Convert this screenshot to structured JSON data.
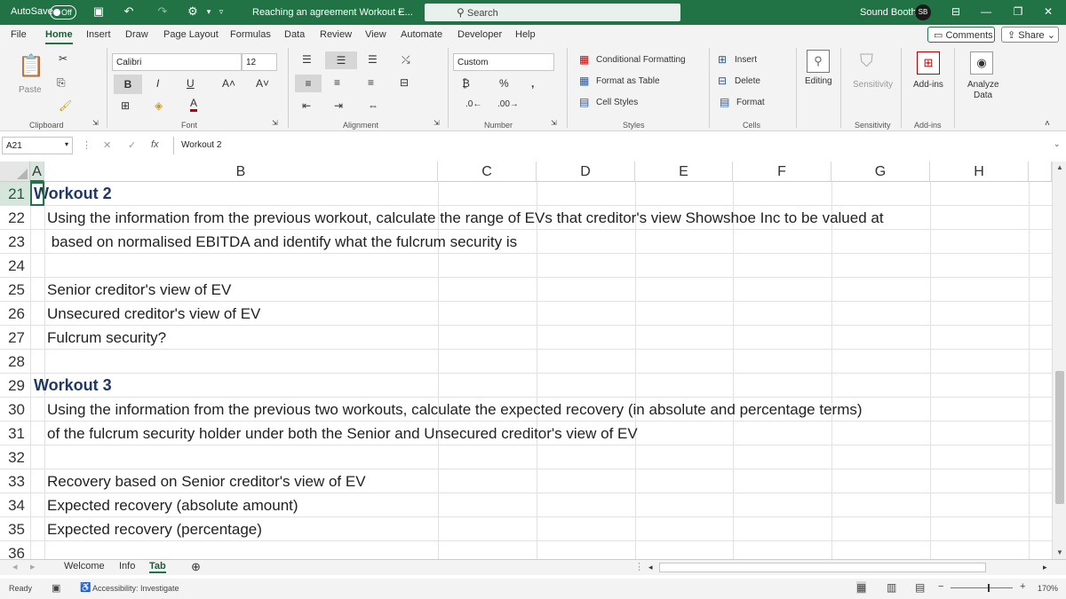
{
  "titlebar": {
    "autosave_label": "AutoSave",
    "autosave_state": "Off",
    "doc_title": "Reaching an agreement Workout E...",
    "search_placeholder": "Search",
    "user_name": "Sound Booth",
    "avatar_initials": "SB"
  },
  "menu": {
    "tabs": [
      "File",
      "Home",
      "Insert",
      "Draw",
      "Page Layout",
      "Formulas",
      "Data",
      "Review",
      "View",
      "Automate",
      "Developer",
      "Help"
    ],
    "active_tab": "Home",
    "comments_label": "Comments",
    "share_label": "Share"
  },
  "ribbon": {
    "clipboard": {
      "paste_label": "Paste",
      "group_label": "Clipboard"
    },
    "font": {
      "font_name": "Calibri",
      "font_size": "12",
      "group_label": "Font"
    },
    "alignment": {
      "group_label": "Alignment"
    },
    "number": {
      "format": "Custom",
      "group_label": "Number"
    },
    "styles": {
      "conditional_formatting": "Conditional Formatting",
      "format_as_table": "Format as Table",
      "cell_styles": "Cell Styles",
      "group_label": "Styles"
    },
    "cells": {
      "insert": "Insert",
      "delete": "Delete",
      "format": "Format",
      "group_label": "Cells"
    },
    "editing": {
      "label": "Editing"
    },
    "sensitivity": {
      "label": "Sensitivity",
      "group_label": "Sensitivity"
    },
    "addins": {
      "label": "Add-ins",
      "group_label": "Add-ins"
    },
    "analyze": {
      "label_line1": "Analyze",
      "label_line2": "Data"
    }
  },
  "formula_bar": {
    "cell_ref": "A21",
    "fx_symbol": "fx",
    "value": "Workout 2"
  },
  "columns": [
    "A",
    "B",
    "C",
    "D",
    "E",
    "F",
    "G",
    "H"
  ],
  "rows": [
    {
      "num": "21",
      "text": "Workout 2",
      "style": "head"
    },
    {
      "num": "22",
      "text": "Using the information from the previous workout, calculate the range of EVs that creditor's view Showshoe Inc to be valued at",
      "style": "body"
    },
    {
      "num": "23",
      "text": " based on normalised EBITDA and identify what the fulcrum security is",
      "style": "body"
    },
    {
      "num": "24",
      "text": "",
      "style": "body"
    },
    {
      "num": "25",
      "text": "Senior creditor's view of EV",
      "style": "body"
    },
    {
      "num": "26",
      "text": "Unsecured creditor's view of EV",
      "style": "body"
    },
    {
      "num": "27",
      "text": "Fulcrum security?",
      "style": "body"
    },
    {
      "num": "28",
      "text": "",
      "style": "body"
    },
    {
      "num": "29",
      "text": "Workout 3",
      "style": "head"
    },
    {
      "num": "30",
      "text": "Using the information from the previous two workouts, calculate the expected recovery (in absolute and percentage terms)",
      "style": "body"
    },
    {
      "num": "31",
      "text": "of the fulcrum security holder under both the Senior and Unsecured creditor's view of EV",
      "style": "body"
    },
    {
      "num": "32",
      "text": "",
      "style": "body"
    },
    {
      "num": "33",
      "text": "Recovery based on Senior creditor's view of EV",
      "style": "body"
    },
    {
      "num": "34",
      "text": "Expected recovery (absolute amount)",
      "style": "body"
    },
    {
      "num": "35",
      "text": "Expected recovery (percentage)",
      "style": "body"
    },
    {
      "num": "36",
      "text": "",
      "style": "body"
    }
  ],
  "sheets": {
    "tabs": [
      "Welcome",
      "Info",
      "Tab"
    ],
    "active": "Tab"
  },
  "status": {
    "ready": "Ready",
    "accessibility": "Accessibility: Investigate",
    "zoom": "170%"
  }
}
